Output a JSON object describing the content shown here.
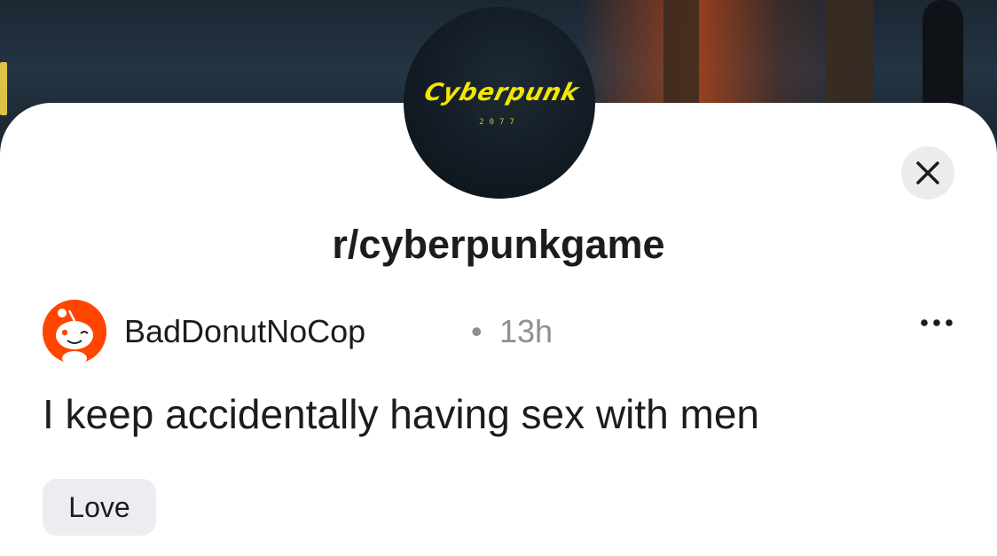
{
  "community": {
    "name": "r/cyberpunkgame",
    "avatar_logo_text": "Cyberpunk",
    "avatar_logo_sub": "2077"
  },
  "post": {
    "author": "BadDonutNoCop",
    "separator": "•",
    "time_ago": "13h",
    "title": "I keep accidentally having sex with men",
    "flair": "Love"
  },
  "icons": {
    "close": "close-icon",
    "more": "more-options-icon",
    "avatar": "snoo-avatar-icon"
  },
  "colors": {
    "snoo_orange": "#ff4500",
    "text_primary": "#1c1c1e",
    "text_secondary": "#8e8e93",
    "chip_bg": "#ececf1",
    "logo_yellow": "#f3e600"
  }
}
